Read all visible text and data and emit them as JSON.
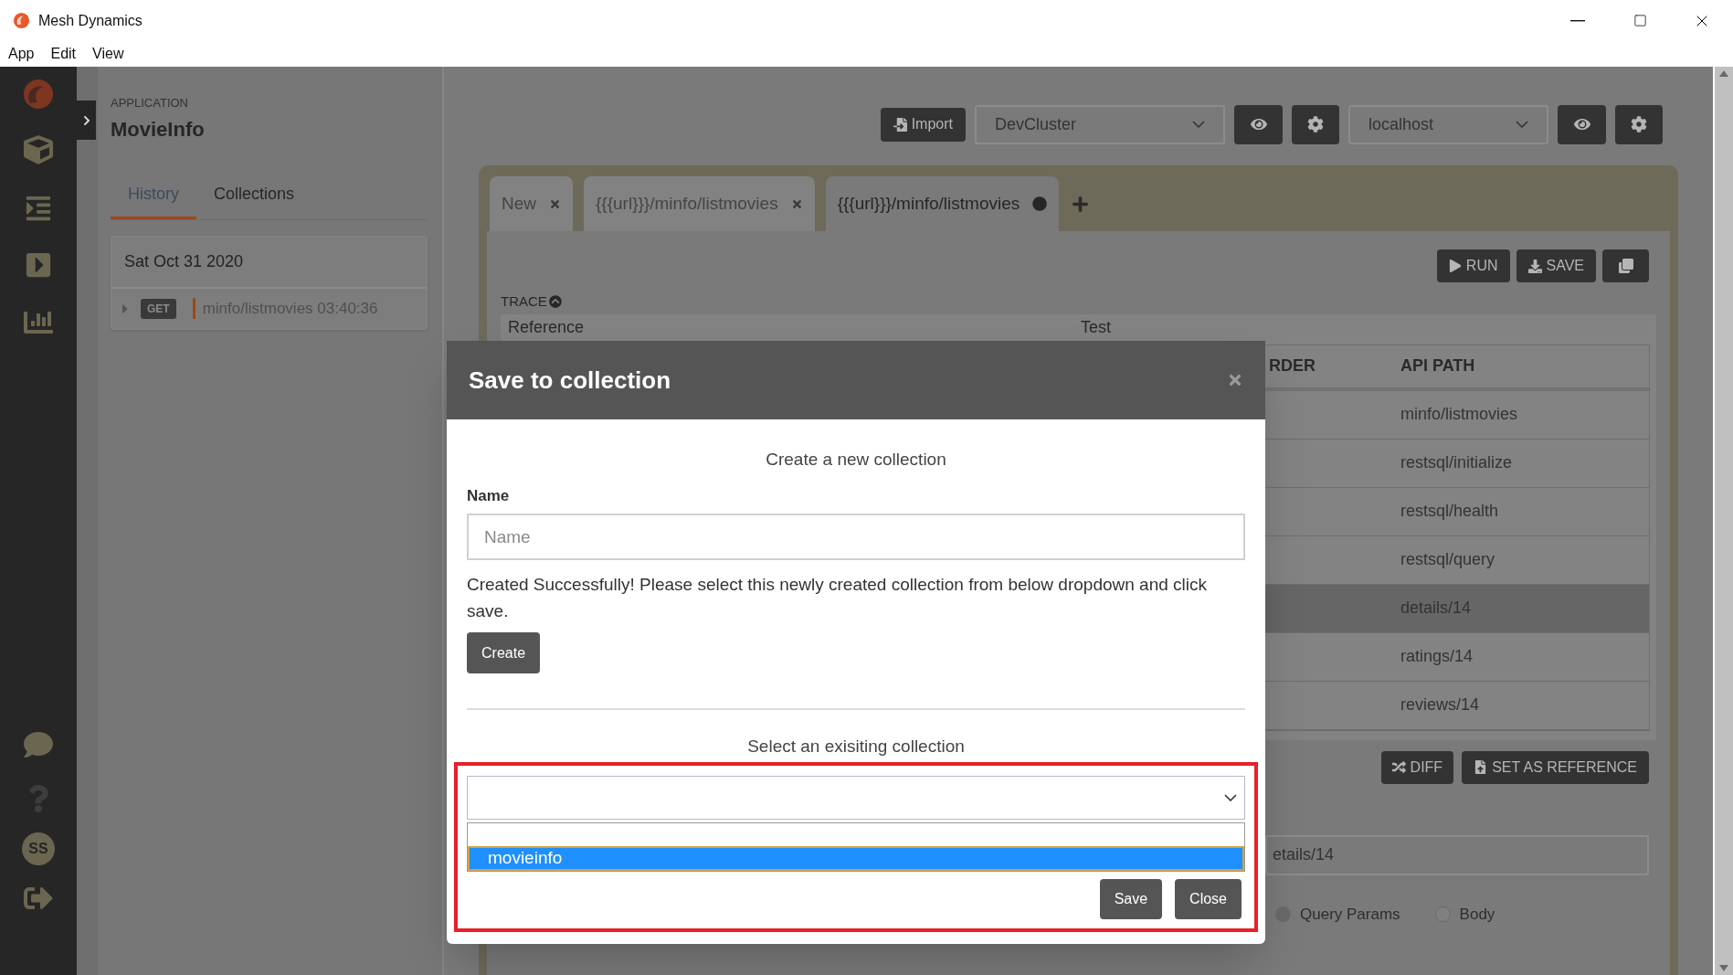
{
  "window": {
    "title": "Mesh Dynamics"
  },
  "menu": [
    "App",
    "Edit",
    "View"
  ],
  "nav": {
    "avatar": "SS"
  },
  "sidebar": {
    "caption": "APPLICATION",
    "app_name": "MovieInfo",
    "tabs": [
      {
        "label": "History",
        "selected": true
      },
      {
        "label": "Collections",
        "selected": false
      }
    ],
    "history": [
      {
        "date": "Sat Oct 31 2020",
        "requests": [
          {
            "method": "GET",
            "path": "minfo/listmovies 03:40:36"
          }
        ]
      }
    ]
  },
  "toolbar": {
    "import": "Import",
    "environment": "DevCluster",
    "host": "localhost"
  },
  "request_tabs": [
    {
      "label": "New",
      "selected": false,
      "unsaved": false
    },
    {
      "label": "{{{url}}}/minfo/listmovies",
      "selected": false,
      "unsaved": false
    },
    {
      "label": "{{{url}}}/minfo/listmovies",
      "selected": true,
      "unsaved": true
    }
  ],
  "actions": [
    "RUN",
    "SAVE"
  ],
  "trace": {
    "label": "TRACE",
    "expanded": true
  },
  "compare_header": [
    "Reference",
    "Test"
  ],
  "table": {
    "columns": [
      "RDER",
      "API PATH"
    ],
    "rows": [
      {
        "api_path": "minfo/listmovies",
        "selected": false
      },
      {
        "api_path": "restsql/initialize",
        "selected": false
      },
      {
        "api_path": "restsql/health",
        "selected": false
      },
      {
        "api_path": "restsql/query",
        "selected": false
      },
      {
        "api_path": "details/14",
        "selected": true
      },
      {
        "api_path": "ratings/14",
        "selected": false
      },
      {
        "api_path": "reviews/14",
        "selected": false
      }
    ]
  },
  "trace_actions": [
    "DIFF",
    "SET AS REFERENCE"
  ],
  "url_field": {
    "value": "etails/14"
  },
  "param_options": [
    {
      "label": "Query Params",
      "selected": true
    },
    {
      "label": "Body",
      "selected": false
    }
  ],
  "dialog": {
    "title": "Save to collection",
    "create_heading": "Create a new collection",
    "name_label": "Name",
    "name_placeholder": "Name",
    "message": "Created Successfully! Please select this newly created collection from below dropdown and click save.",
    "create_button": "Create",
    "select_heading": "Select an exisiting collection",
    "options": [
      {
        "label": "movieinfo",
        "selected": true
      }
    ],
    "buttons": [
      "Save",
      "Close"
    ]
  }
}
